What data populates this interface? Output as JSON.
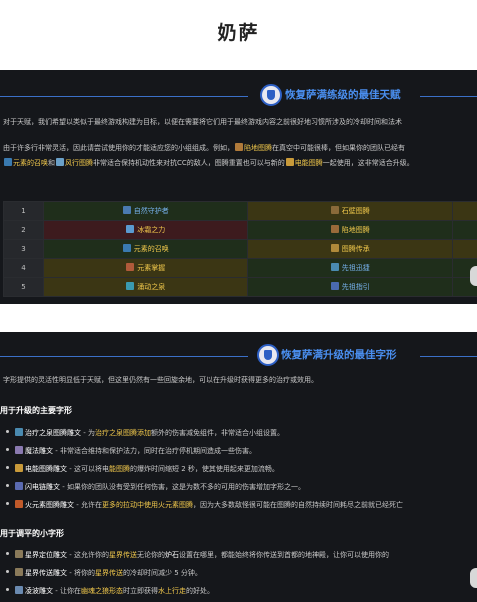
{
  "page": {
    "title": "奶萨"
  },
  "panel_talents": {
    "header": "恢复萨满练级的最佳天赋",
    "para1": "对于天赋，我们希望以类似于最终游戏构建为目标，以便在需要将它们用于最终游戏内容之前很好地习惯所涉及的冷却时间和法术",
    "para2": {
      "a": "由于许多行非常灵活，因此请尝试使用你的才能适应您的小组组成。例如，",
      "b": "陷地图腾",
      "c": "在真空中可能很棒，但如果你的团队已经有"
    },
    "para3": {
      "a": "元素的召唤",
      "b": "和",
      "c": "风行图腾",
      "d": "非常适合保持机动性来对抗CC的敌人，图腾重置也可以与新的",
      "e": "电能图腾",
      "f": "一起使用，这非常适合升级。"
    },
    "table": [
      {
        "num": "1",
        "left": "自然守护者",
        "right": "石壁图腾",
        "left_color": "green",
        "right_color": "yellow"
      },
      {
        "num": "2",
        "left": "冰霜之力",
        "right": "陷地图腾",
        "left_color": "red",
        "right_color": "green"
      },
      {
        "num": "3",
        "left": "元素的召唤",
        "right": "图腾传承",
        "left_color": "green",
        "right_color": "yellow"
      },
      {
        "num": "4",
        "left": "元素掌握",
        "right": "先祖迅捷",
        "left_color": "yellow",
        "right_color": "green"
      },
      {
        "num": "5",
        "left": "涌动之泉",
        "right": "先祖指引",
        "left_color": "yellow",
        "right_color": "green"
      }
    ]
  },
  "panel_glyphs": {
    "header": "恢复萨满升级的最佳字形",
    "intro": "字形提供的灵活性明显低于天赋，但这里仍然有一些回旋余地，可以在升级时获得更多的治疗或效用。",
    "major_title": "用于升级的主要字形",
    "major": [
      {
        "name": "治疗之泉图腾雕文",
        "a": " - 为",
        "b": "治疗之泉图腾添加",
        "c": "额外的伤害减免组件，非常适合小组设置。"
      },
      {
        "name": "魔法雕文",
        "a": " - 非常适合维持和保护法力，同时在治疗停机期间造成一些伤害。",
        "b": "",
        "c": ""
      },
      {
        "name": "电能图腾雕文",
        "a": " - 这可以将电",
        "b": "能图腾",
        "c": "的爆炸时间缩短 2 秒，使其使用起来更加流畅。"
      },
      {
        "name": "闪电链雕文",
        "a": " - 如果你的团队没有受到任何伤害，这是为数不多的可用的伤害增加字形之一。",
        "b": "",
        "c": ""
      },
      {
        "name": "火元素图腾雕文",
        "a": " - 允许在",
        "b": "更多的拉动中使用火元素图腾",
        "c": "，因为大多数敌怪很可能在图腾的自然持续时间耗尽之前就已经死亡"
      }
    ],
    "minor_title": "用于调平的小字形",
    "minor": [
      {
        "name": "星界定位雕文",
        "a": " - 这允许你的",
        "b": "星界传送",
        "c": "无论你的",
        "d": "炉石",
        "e": "设置在哪里，都能始终将你传送到首都的地神殿，让你可以使用你的"
      },
      {
        "name": "星界传送雕文",
        "a": " - 将你的",
        "b": "星界传送",
        "c": "的冷却时间减少 5 分钟。",
        "d": "",
        "e": ""
      },
      {
        "name": "凌波雕文",
        "a": " - 让你在",
        "b": "幽魂之狼形态",
        "c": "时",
        "d": "立即获得",
        "e": "水上行走",
        "f": "的好处。"
      }
    ]
  },
  "colors": {
    "accent_blue": "#4a8ff0",
    "highlight_yellow": "#f2c94c",
    "panel_bg": "#15171b"
  },
  "icons": [
    "shaman-emblem-icon",
    "totem-icon",
    "spell-icon",
    "scroll-tab-icon"
  ]
}
